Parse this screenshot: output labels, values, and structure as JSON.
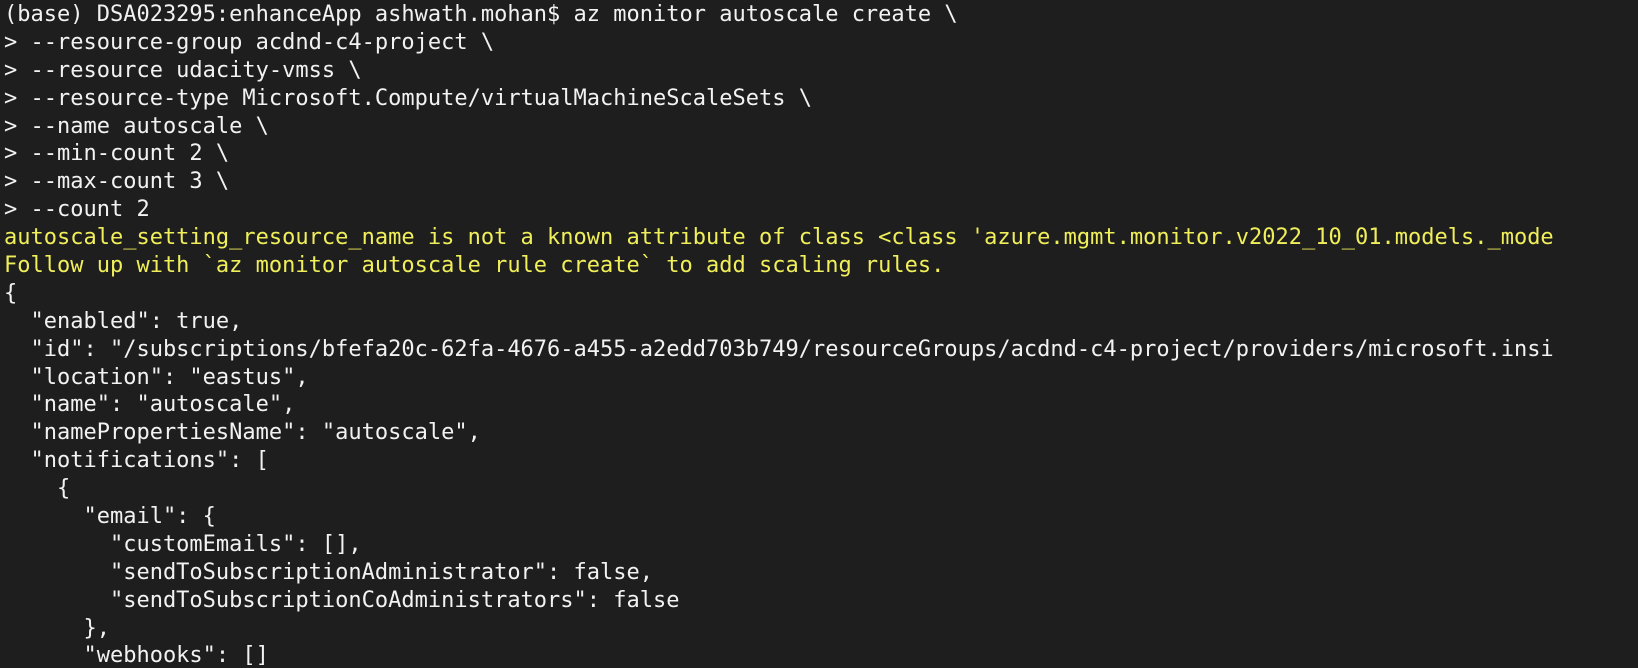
{
  "colors": {
    "background": "#1e1e1e",
    "foreground": "#f2f2f2",
    "warning": "#f0ef5a"
  },
  "terminal": {
    "lines": [
      {
        "text": "(base) DSA023295:enhanceApp ashwath.mohan$ az monitor autoscale create \\",
        "style": "normal"
      },
      {
        "text": "> --resource-group acdnd-c4-project \\",
        "style": "normal"
      },
      {
        "text": "> --resource udacity-vmss \\",
        "style": "normal"
      },
      {
        "text": "> --resource-type Microsoft.Compute/virtualMachineScaleSets \\",
        "style": "normal"
      },
      {
        "text": "> --name autoscale \\",
        "style": "normal"
      },
      {
        "text": "> --min-count 2 \\",
        "style": "normal"
      },
      {
        "text": "> --max-count 3 \\",
        "style": "normal"
      },
      {
        "text": "> --count 2",
        "style": "normal"
      },
      {
        "text": "autoscale_setting_resource_name is not a known attribute of class <class 'azure.mgmt.monitor.v2022_10_01.models._mode",
        "style": "warning"
      },
      {
        "text": "Follow up with `az monitor autoscale rule create` to add scaling rules.",
        "style": "warning"
      },
      {
        "text": "{",
        "style": "normal"
      },
      {
        "text": "  \"enabled\": true,",
        "style": "normal"
      },
      {
        "text": "  \"id\": \"/subscriptions/bfefa20c-62fa-4676-a455-a2edd703b749/resourceGroups/acdnd-c4-project/providers/microsoft.insi",
        "style": "normal"
      },
      {
        "text": "  \"location\": \"eastus\",",
        "style": "normal"
      },
      {
        "text": "  \"name\": \"autoscale\",",
        "style": "normal"
      },
      {
        "text": "  \"namePropertiesName\": \"autoscale\",",
        "style": "normal"
      },
      {
        "text": "  \"notifications\": [",
        "style": "normal"
      },
      {
        "text": "    {",
        "style": "normal"
      },
      {
        "text": "      \"email\": {",
        "style": "normal"
      },
      {
        "text": "        \"customEmails\": [],",
        "style": "normal"
      },
      {
        "text": "        \"sendToSubscriptionAdministrator\": false,",
        "style": "normal"
      },
      {
        "text": "        \"sendToSubscriptionCoAdministrators\": false",
        "style": "normal"
      },
      {
        "text": "      },",
        "style": "normal"
      },
      {
        "text": "      \"webhooks\": []",
        "style": "normal"
      }
    ]
  }
}
